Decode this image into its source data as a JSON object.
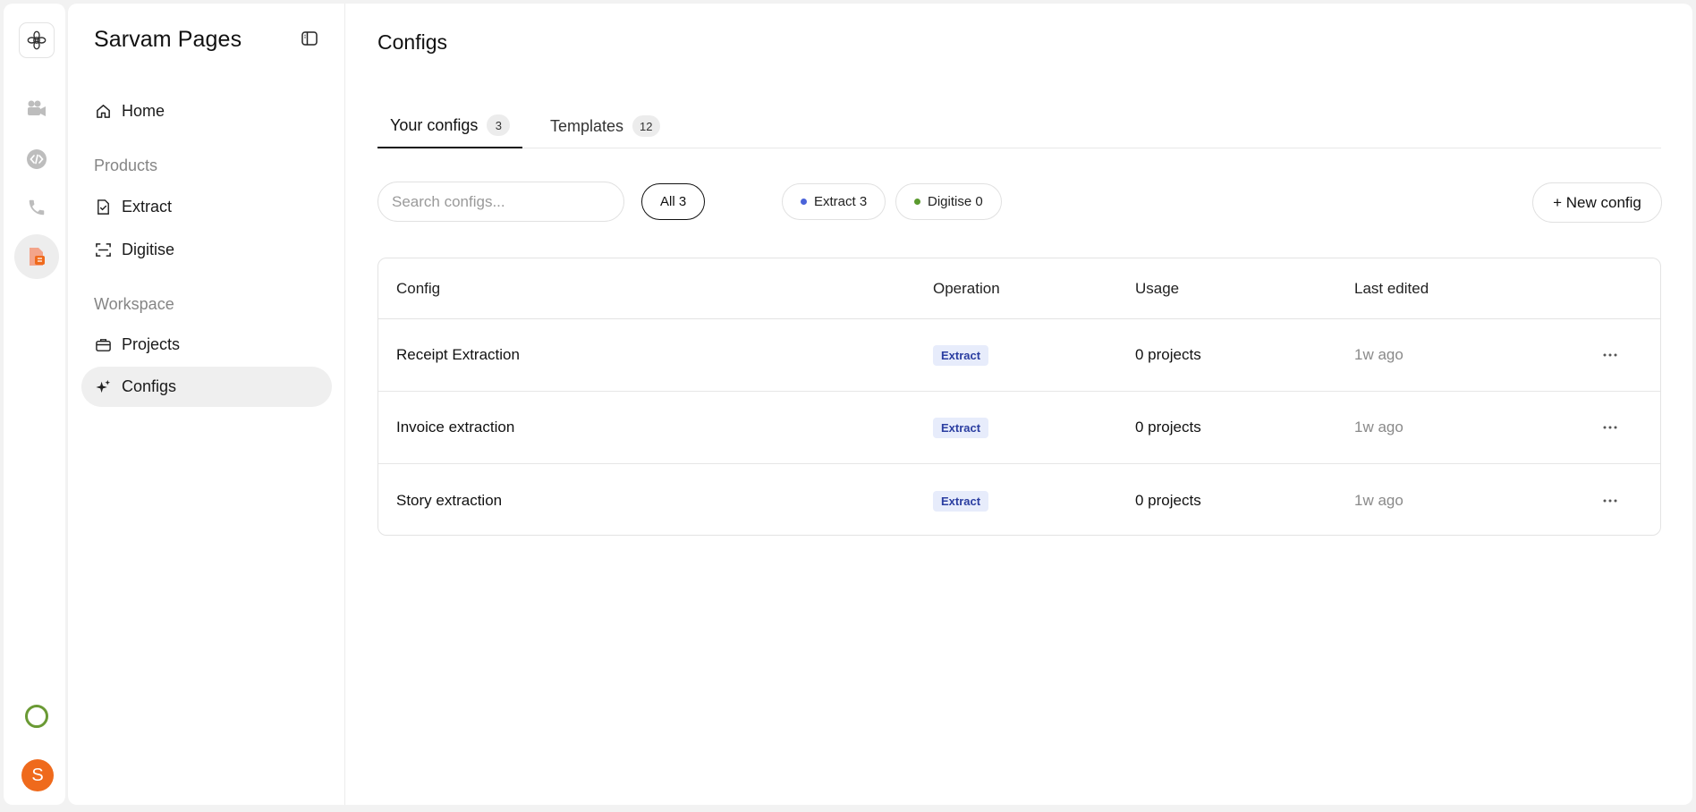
{
  "app": {
    "brand": "Sarvam Pages"
  },
  "rail": {
    "items": [
      {
        "icon": "flower-logo-icon"
      },
      {
        "icon": "video-camera-icon"
      },
      {
        "icon": "code-icon"
      },
      {
        "icon": "phone-icon"
      },
      {
        "icon": "document-extract-icon",
        "active": true
      }
    ],
    "avatar_letter": "S",
    "status_color": "#6a9a34",
    "avatar_color": "#ef6a1c"
  },
  "sidebar": {
    "home": "Home",
    "products_heading": "Products",
    "extract": "Extract",
    "digitise": "Digitise",
    "workspace_heading": "Workspace",
    "projects": "Projects",
    "configs": "Configs"
  },
  "main": {
    "title": "Configs",
    "tabs": [
      {
        "label": "Your configs",
        "count": "3",
        "active": true
      },
      {
        "label": "Templates",
        "count": "12",
        "active": false
      }
    ],
    "search": {
      "placeholder": "Search configs..."
    },
    "filters": [
      {
        "label": "All 3",
        "active": true
      },
      {
        "label": "Extract 3",
        "dot": "#4a63d9"
      },
      {
        "label": "Digitise 0",
        "dot": "#5a9a2e"
      }
    ],
    "new_button": "+ New config",
    "table": {
      "headers": {
        "config": "Config",
        "operation": "Operation",
        "usage": "Usage",
        "edited": "Last edited"
      },
      "rows": [
        {
          "config": "Receipt Extraction",
          "operation": "Extract",
          "usage": "0 projects",
          "edited": "1w ago"
        },
        {
          "config": "Invoice extraction",
          "operation": "Extract",
          "usage": "0 projects",
          "edited": "1w ago"
        },
        {
          "config": "Story extraction",
          "operation": "Extract",
          "usage": "0 projects",
          "edited": "1w ago"
        }
      ]
    }
  }
}
